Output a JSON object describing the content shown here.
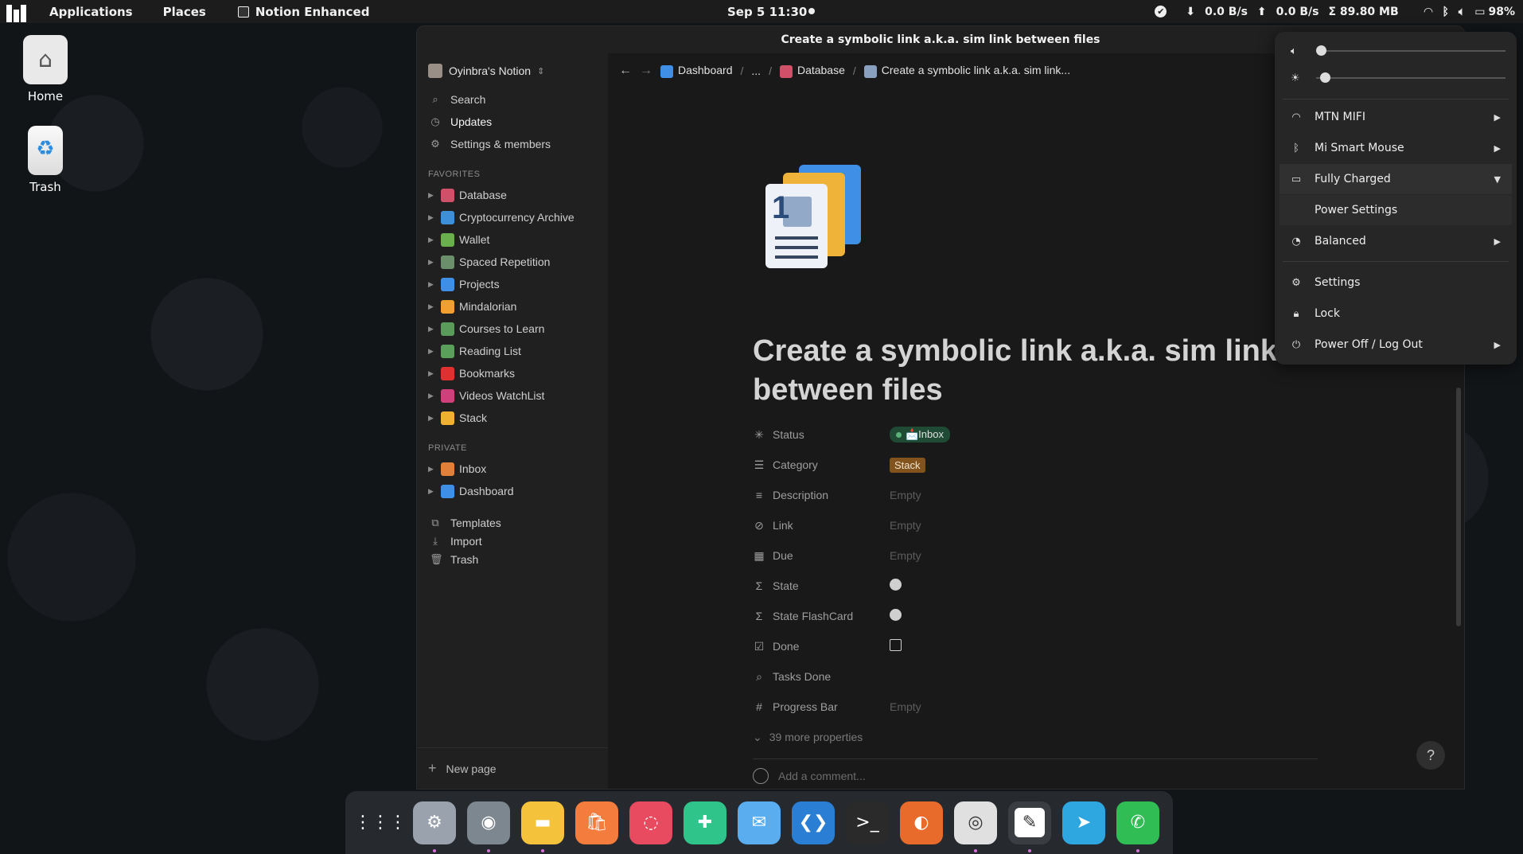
{
  "topbar": {
    "applications": "Applications",
    "places": "Places",
    "app_name": "Notion Enhanced",
    "clock": "Sep 5  11:30",
    "down_rate": "0.0  B/s",
    "up_rate": "0.0  B/s",
    "memory": "Σ  89.80 MB",
    "battery": "98%"
  },
  "desktop": {
    "home_label": "Home",
    "trash_label": "Trash"
  },
  "window": {
    "title": "Create a symbolic link a.k.a. sim link between files"
  },
  "sidebar": {
    "workspace": "Oyinbra's Notion",
    "nav": [
      {
        "label": "Search",
        "icon": "search-icon"
      },
      {
        "label": "Updates",
        "icon": "clock-icon"
      },
      {
        "label": "Settings & members",
        "icon": "gear-icon"
      }
    ],
    "favorites_label": "FAVORITES",
    "favorites": [
      {
        "label": "Database",
        "color": "#d0506a"
      },
      {
        "label": "Cryptocurrency Archive",
        "color": "#3e8fd8"
      },
      {
        "label": "Wallet",
        "color": "#6ab04c"
      },
      {
        "label": "Spaced Repetition",
        "color": "#6b8e6b"
      },
      {
        "label": "Projects",
        "color": "#3f8fe6"
      },
      {
        "label": "Mindalorian",
        "color": "#f0a030"
      },
      {
        "label": "Courses to Learn",
        "color": "#5a9a5a"
      },
      {
        "label": "Reading List",
        "color": "#5aa05a"
      },
      {
        "label": "Bookmarks",
        "color": "#e03030"
      },
      {
        "label": "Videos WatchList",
        "color": "#d0407a"
      },
      {
        "label": "Stack",
        "color": "#f0b030"
      }
    ],
    "private_label": "PRIVATE",
    "private": [
      {
        "label": "Inbox",
        "color": "#e0803a"
      },
      {
        "label": "Dashboard",
        "color": "#3f8fe6"
      }
    ],
    "tools": [
      {
        "label": "Templates",
        "icon": "templates-icon"
      },
      {
        "label": "Import",
        "icon": "import-icon"
      },
      {
        "label": "Trash",
        "icon": "trash-icon"
      }
    ],
    "new_page": "New page"
  },
  "breadcrumb": {
    "dashboard": "Dashboard",
    "ellipsis": "...",
    "database": "Database",
    "current": "Create a symbolic link a.k.a. sim link..."
  },
  "page": {
    "title": "Create a symbolic link a.k.a. sim link between files",
    "properties": [
      {
        "name": "Status",
        "icon": "status-icon",
        "value": "📩Inbox",
        "type": "status"
      },
      {
        "name": "Category",
        "icon": "list-icon",
        "value": "Stack",
        "type": "category"
      },
      {
        "name": "Description",
        "icon": "text-icon",
        "value": "Empty",
        "type": "empty"
      },
      {
        "name": "Link",
        "icon": "link-icon",
        "value": "Empty",
        "type": "empty"
      },
      {
        "name": "Due",
        "icon": "calendar-icon",
        "value": "Empty",
        "type": "empty"
      },
      {
        "name": "State",
        "icon": "formula-icon",
        "value": "",
        "type": "dot"
      },
      {
        "name": "State FlashCard",
        "icon": "formula-icon",
        "value": "",
        "type": "dot"
      },
      {
        "name": "Done",
        "icon": "checkbox-icon",
        "value": "",
        "type": "checkbox"
      },
      {
        "name": "Tasks Done",
        "icon": "search-icon",
        "value": "",
        "type": "blank"
      },
      {
        "name": "Progress Bar",
        "icon": "number-icon",
        "value": "Empty",
        "type": "empty"
      }
    ],
    "more_properties": "39 more properties",
    "comment_placeholder": "Add a comment..."
  },
  "system_menu": {
    "volume_level": 0.0,
    "brightness_level": 0.03,
    "items": [
      {
        "label": "MTN MIFI",
        "icon": "wifi-icon"
      },
      {
        "label": "Mi Smart Mouse",
        "icon": "bluetooth-icon"
      },
      {
        "label": "Fully Charged",
        "icon": "battery-icon"
      },
      {
        "label": "Power Settings",
        "icon": ""
      },
      {
        "label": "Balanced",
        "icon": "power-mode-icon"
      },
      {
        "label": "Settings",
        "icon": "settings-icon"
      },
      {
        "label": "Lock",
        "icon": "lock-icon"
      },
      {
        "label": "Power Off / Log Out",
        "icon": "power-icon"
      }
    ]
  },
  "dock": [
    {
      "name": "app-grid",
      "color": "#262a2e"
    },
    {
      "name": "system-settings",
      "color": "#9aa3ad"
    },
    {
      "name": "screenshot",
      "color": "#7d8790"
    },
    {
      "name": "files",
      "color": "#f5c33b"
    },
    {
      "name": "app-store",
      "color": "#f47c3c"
    },
    {
      "name": "backup",
      "color": "#e84a5f"
    },
    {
      "name": "extensions",
      "color": "#2fc48a"
    },
    {
      "name": "mail",
      "color": "#5aaef0"
    },
    {
      "name": "vscode",
      "color": "#2a7fd4"
    },
    {
      "name": "terminal",
      "color": "#2a2a2a"
    },
    {
      "name": "firefox",
      "color": "#e96b2b"
    },
    {
      "name": "chrome",
      "color": "#e0e0e0"
    },
    {
      "name": "notion-enhanced",
      "color": "#ffffff"
    },
    {
      "name": "telegram",
      "color": "#2ea6e0"
    },
    {
      "name": "whatsapp",
      "color": "#2fbd54"
    }
  ]
}
